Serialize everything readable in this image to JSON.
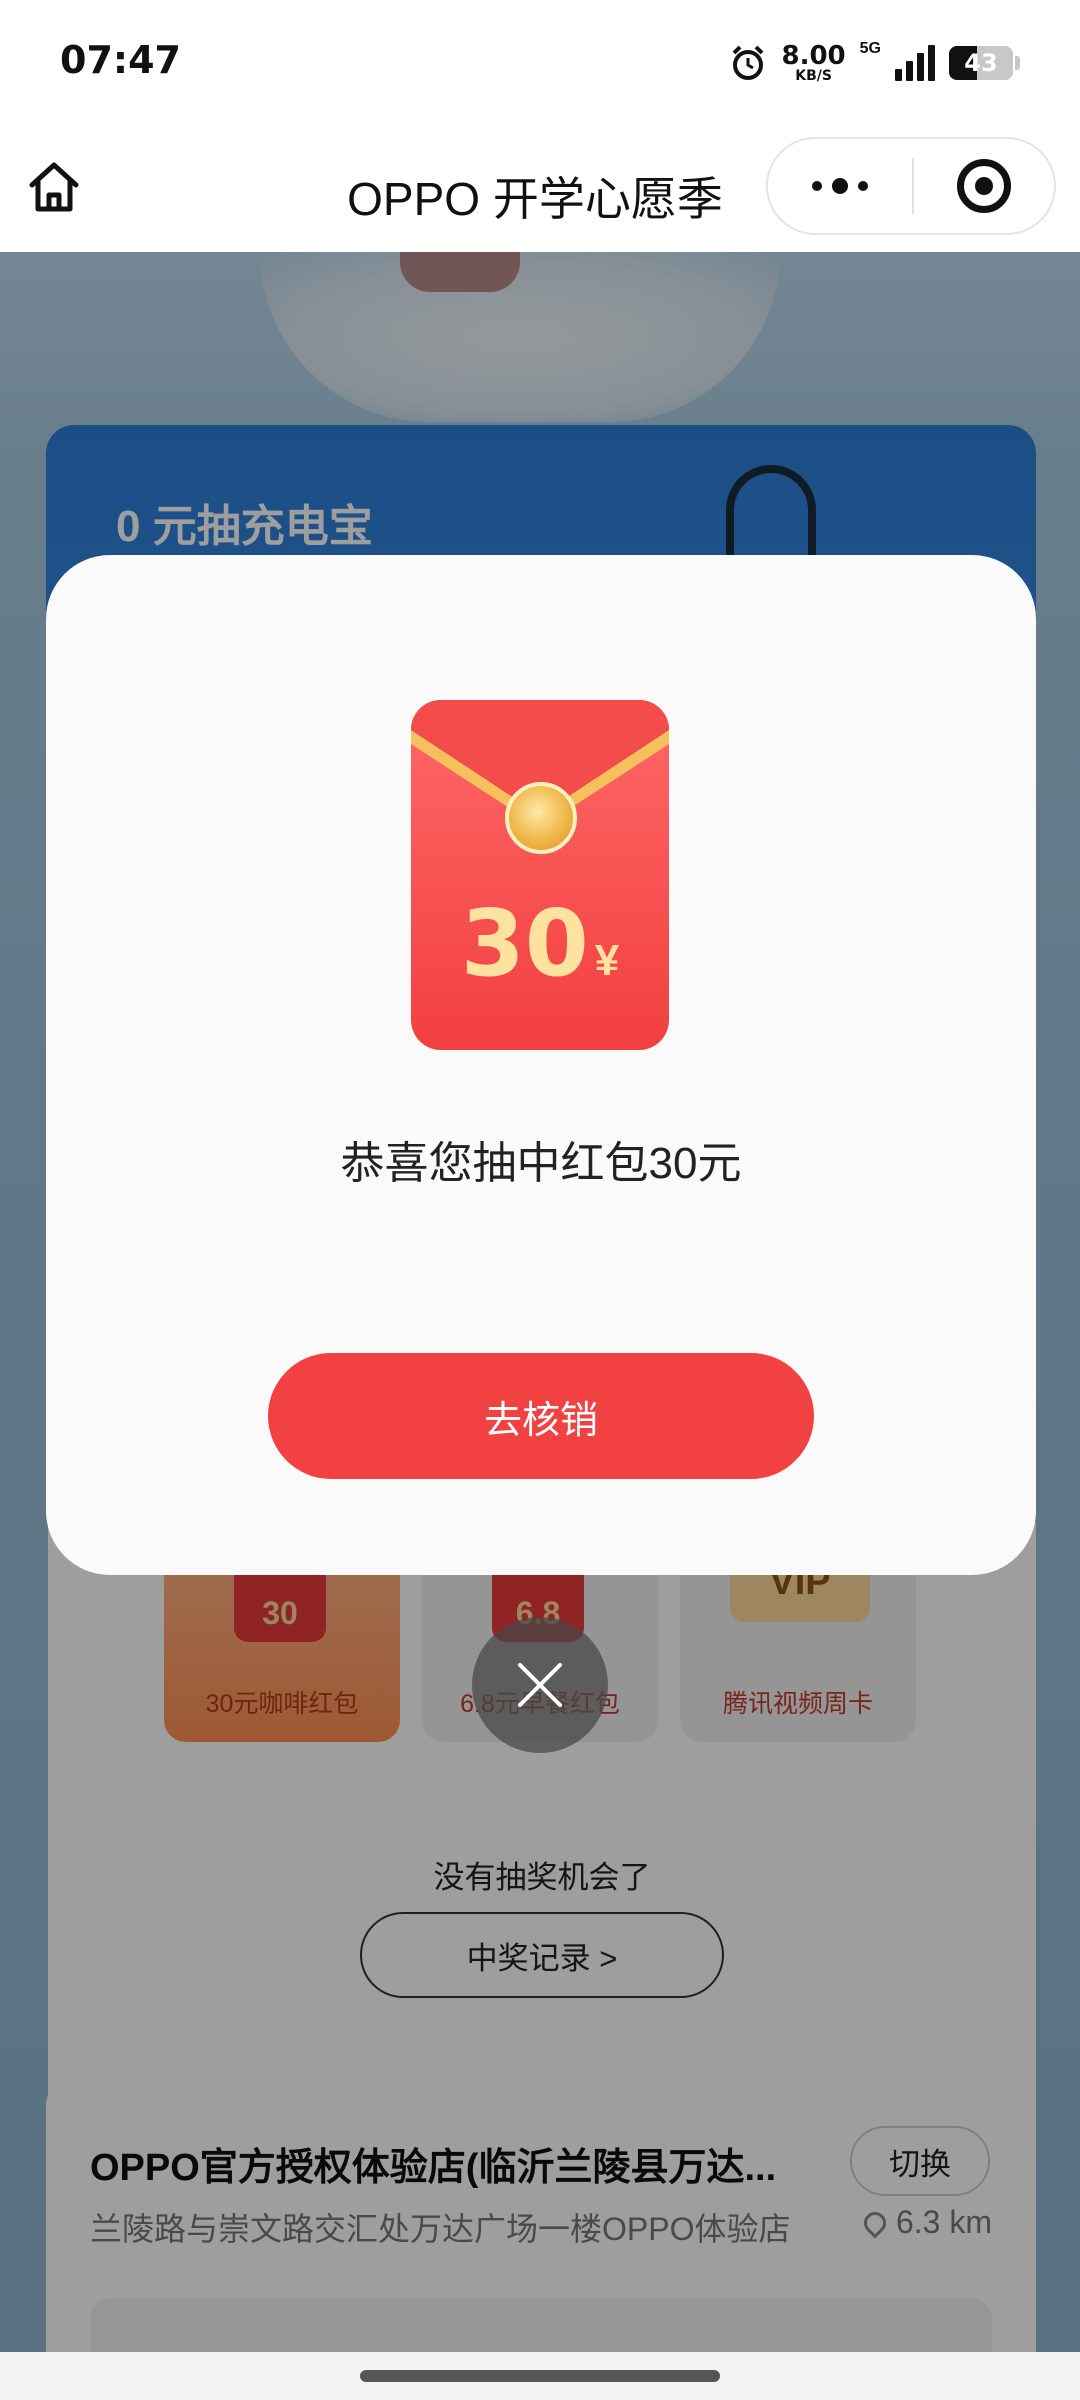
{
  "status_bar": {
    "time": "07:47",
    "net_speed_value": "8.00",
    "net_speed_unit": "KB/S",
    "network_type": "5G",
    "battery_level": "43",
    "battery_fraction": 0.43
  },
  "nav": {
    "title": "OPPO 开学心愿季"
  },
  "background": {
    "promo_title": "0 元抽充电宝",
    "prizes": [
      {
        "label": "30元咖啡红包",
        "thumb": "30"
      },
      {
        "label": "6.8元早餐红包",
        "thumb": "6.8"
      },
      {
        "label": "腾讯视频周卡",
        "thumb": "VIP"
      }
    ],
    "no_chance_text": "没有抽奖机会了",
    "record_button": "中奖记录 >",
    "store": {
      "name": "OPPO官方授权体验店(临沂兰陵县万达...",
      "switch_label": "切换",
      "address": "兰陵路与崇文路交汇处万达广场一楼OPPO体验店",
      "distance": "6.3 km"
    }
  },
  "modal": {
    "envelope_amount": "30",
    "envelope_currency": "¥",
    "message": "恭喜您抽中红包30元",
    "button_label": "去核销"
  },
  "icons": {
    "home": "home-icon",
    "more": "more-dots-icon",
    "target": "target-icon",
    "close": "close-icon",
    "alarm": "alarm-icon",
    "location": "location-pin-icon"
  },
  "colors": {
    "primary_red": "#f24141",
    "envelope_gold": "#ffe1a0"
  }
}
